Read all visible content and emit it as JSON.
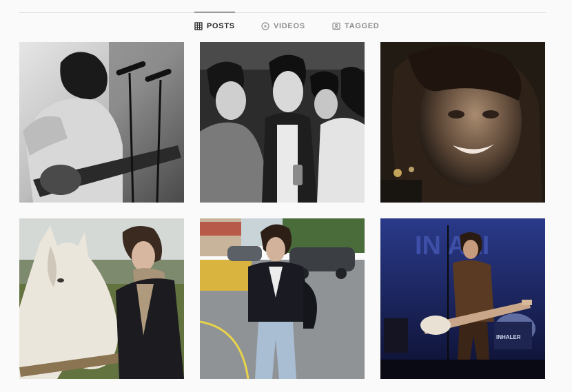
{
  "tabs": [
    {
      "label": "POSTS",
      "icon": "grid-icon",
      "active": true
    },
    {
      "label": "VIDEOS",
      "icon": "play-circle-icon",
      "active": false
    },
    {
      "label": "TAGGED",
      "icon": "tag-user-icon",
      "active": false
    }
  ],
  "posts": [
    {
      "desc": "black-and-white concert photo of guitarist at microphone"
    },
    {
      "desc": "black-and-white photo of four young men in a bar"
    },
    {
      "desc": "close-up selfie of smiling young man at night"
    },
    {
      "desc": "young man with scarf beside white pony"
    },
    {
      "desc": "young man in dark jacket and light jeans on street"
    },
    {
      "desc": "guitarist performing on stage under blue light"
    }
  ],
  "stage_sign": "IN ALI",
  "drum_text": "INHALER"
}
